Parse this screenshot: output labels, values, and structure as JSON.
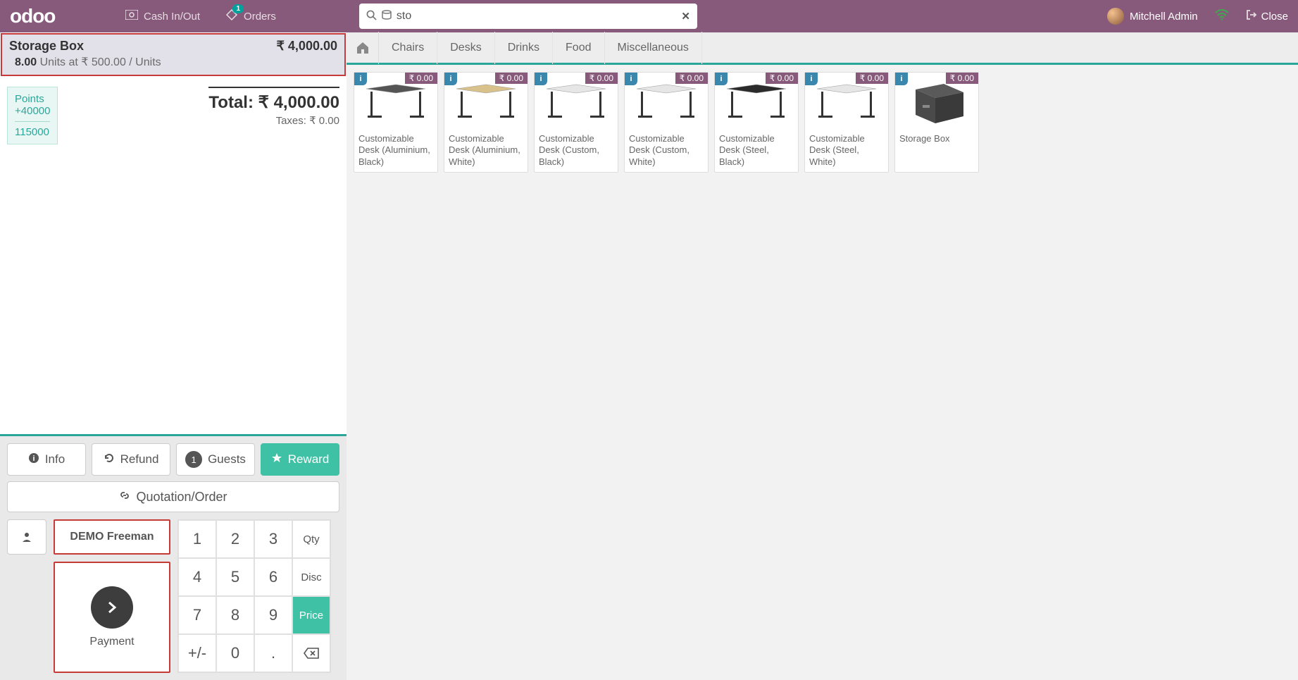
{
  "topbar": {
    "logo_text": "odoo",
    "cash_label": "Cash In/Out",
    "orders_label": "Orders",
    "orders_count": "1",
    "search_value": "sto",
    "user_name": "Mitchell Admin",
    "close_label": "Close"
  },
  "order": {
    "line_name": "Storage Box",
    "line_price": "₹ 4,000.00",
    "line_qty": "8.00",
    "line_unit_text": "Units at ₹ 500.00 / Units",
    "points_label": "Points",
    "points_earned": "+40000",
    "points_total": "115000",
    "total_label": "Total: ₹ 4,000.00",
    "taxes_label": "Taxes: ₹ 0.00"
  },
  "actions": {
    "info": "Info",
    "refund": "Refund",
    "guests": "Guests",
    "guests_count": "1",
    "reward": "Reward",
    "quotation": "Quotation/Order"
  },
  "customer": {
    "name": "DEMO Freeman",
    "payment_label": "Payment"
  },
  "numpad": {
    "k1": "1",
    "k2": "2",
    "k3": "3",
    "qty": "Qty",
    "k4": "4",
    "k5": "5",
    "k6": "6",
    "disc": "Disc",
    "k7": "7",
    "k8": "8",
    "k9": "9",
    "price": "Price",
    "pm": "+/-",
    "k0": "0",
    "dot": ".",
    "bsp": "⌫"
  },
  "categories": [
    "Chairs",
    "Desks",
    "Drinks",
    "Food",
    "Miscellaneous"
  ],
  "products": [
    {
      "name": "Customizable Desk (Aluminium, Black)",
      "price": "₹ 0.00",
      "kind": "desk",
      "top": "#555",
      "legs": "#333"
    },
    {
      "name": "Customizable Desk (Aluminium, White)",
      "price": "₹ 0.00",
      "kind": "desk",
      "top": "#d8c18a",
      "legs": "#333"
    },
    {
      "name": "Customizable Desk (Custom, Black)",
      "price": "₹ 0.00",
      "kind": "desk",
      "top": "#e6e6e6",
      "legs": "#333"
    },
    {
      "name": "Customizable Desk (Custom, White)",
      "price": "₹ 0.00",
      "kind": "desk",
      "top": "#e6e6e6",
      "legs": "#333"
    },
    {
      "name": "Customizable Desk (Steel, Black)",
      "price": "₹ 0.00",
      "kind": "desk",
      "top": "#2b2b2b",
      "legs": "#333"
    },
    {
      "name": "Customizable Desk (Steel, White)",
      "price": "₹ 0.00",
      "kind": "desk",
      "top": "#e6e6e6",
      "legs": "#333"
    },
    {
      "name": "Storage Box",
      "price": "₹ 0.00",
      "kind": "box"
    }
  ]
}
